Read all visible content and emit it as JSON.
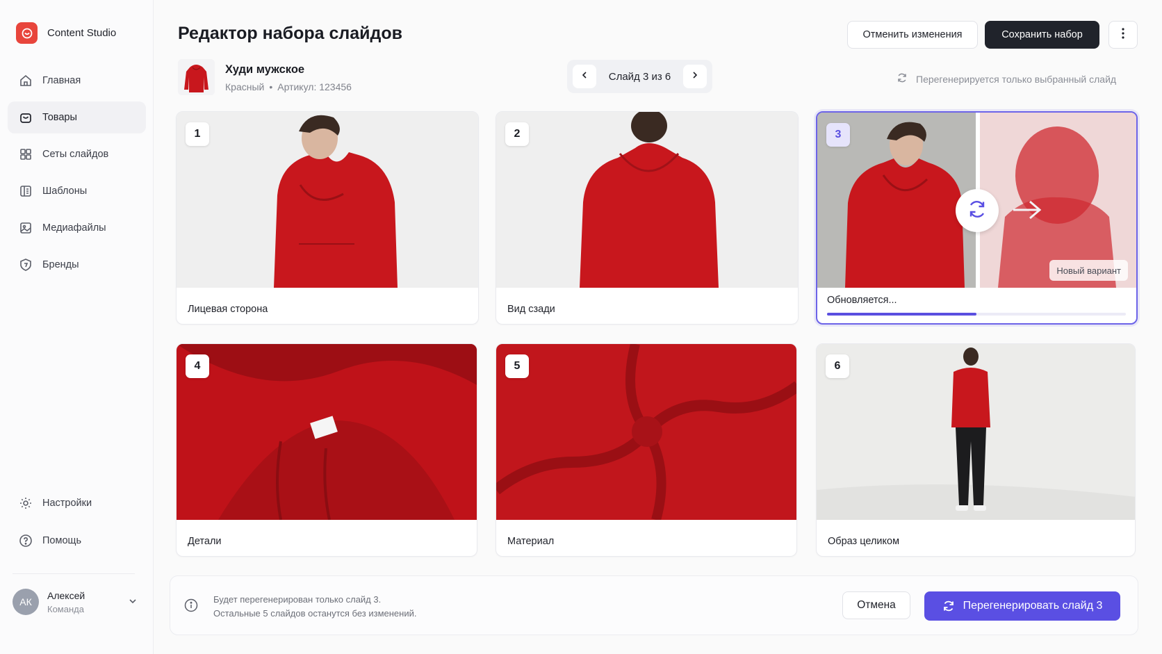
{
  "app": {
    "name": "Content Studio"
  },
  "sidebar": {
    "items": [
      {
        "label": "Главная",
        "icon": "home-icon"
      },
      {
        "label": "Товары",
        "icon": "bag-icon",
        "active": true
      },
      {
        "label": "Сеты слайдов",
        "icon": "grid-icon"
      },
      {
        "label": "Шаблоны",
        "icon": "template-icon"
      },
      {
        "label": "Медиафайлы",
        "icon": "image-icon"
      },
      {
        "label": "Бренды",
        "icon": "brand-icon"
      }
    ],
    "bottom": [
      {
        "label": "Настройки",
        "icon": "gear-icon"
      },
      {
        "label": "Помощь",
        "icon": "help-icon"
      }
    ],
    "user": {
      "initials": "АК",
      "name": "Алексей",
      "team": "Команда"
    }
  },
  "header": {
    "title": "Редактор набора слайдов",
    "discard_label": "Отменить изменения",
    "save_label": "Сохранить набор"
  },
  "product": {
    "name": "Худи мужское",
    "color": "Красный",
    "sku": "Артикул: 123456"
  },
  "pager": {
    "label": "Слайд 3 из 6",
    "current": 3,
    "total": 6
  },
  "regen_hint": "Перегенерируется только выбранный слайд",
  "slides": [
    {
      "number": "1",
      "caption": "Лицевая сторона"
    },
    {
      "number": "2",
      "caption": "Вид сзади"
    },
    {
      "number": "3",
      "caption": "Обновляется...",
      "status": "updating",
      "progress": 0.5,
      "variant_label": "Новый вариант"
    },
    {
      "number": "4",
      "caption": "Детали"
    },
    {
      "number": "5",
      "caption": "Материал"
    },
    {
      "number": "6",
      "caption": "Образ целиком"
    }
  ],
  "bottom_bar": {
    "line1": "Будет перегенерирован только слайд 3.",
    "line2": "Остальные 5 слайдов останутся без изменений.",
    "cancel_label": "Отмена",
    "primary_label": "Перегенерировать слайд 3"
  },
  "colors": {
    "accent": "#5a4fe3",
    "brand": "#e8453c",
    "product_red": "#c8171d"
  }
}
